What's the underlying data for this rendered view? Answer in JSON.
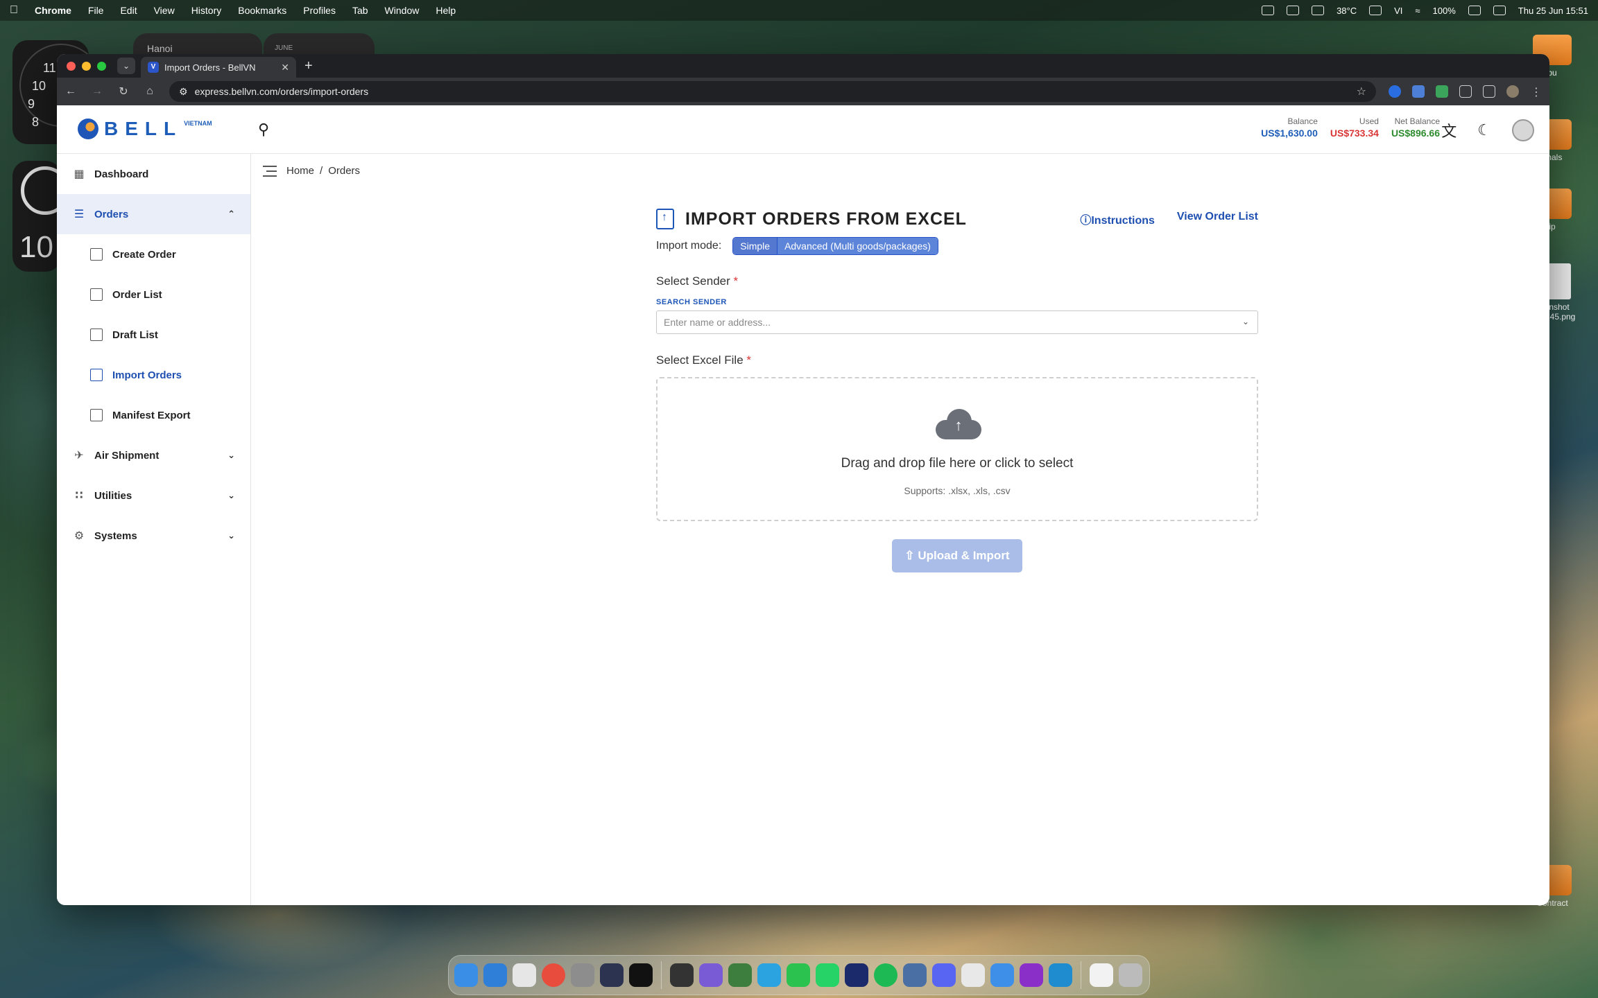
{
  "menubar": {
    "app_name": "Chrome",
    "items": [
      "File",
      "Edit",
      "View",
      "History",
      "Bookmarks",
      "Profiles",
      "Tab",
      "Window",
      "Help"
    ],
    "weather": "38°C",
    "battery": "100%",
    "input_source": "VI",
    "datetime": "Thu 25 Jun  15:51"
  },
  "desktop": {
    "weather_widget": "Hanoi",
    "calendar_widget": "JUNE",
    "battery_widget_value": "10",
    "files": [
      {
        "label": "bu"
      },
      {
        "label": "onals"
      },
      {
        "label": "ip"
      },
      {
        "label": "nshot\n2.45.png"
      },
      {
        "label": "Contract"
      }
    ]
  },
  "browser": {
    "tab_title": "Import Orders - BellVN",
    "url": "express.bellvn.com/orders/import-orders"
  },
  "header": {
    "logo_text": "BELL",
    "logo_sub": "VIETNAM",
    "balance_label": "Balance",
    "balance_value": "US$1,630.00",
    "used_label": "Used",
    "used_value": "US$733.34",
    "net_label": "Net Balance",
    "net_value": "US$896.66",
    "colors": {
      "balance": "#1e5db8",
      "used": "#d93535",
      "net": "#2e8b2e"
    }
  },
  "sidebar": {
    "items": [
      {
        "label": "Dashboard"
      },
      {
        "label": "Orders",
        "expanded": true
      },
      {
        "label": "Air Shipment"
      },
      {
        "label": "Utilities"
      },
      {
        "label": "Systems"
      }
    ],
    "orders_sub": [
      {
        "label": "Create Order"
      },
      {
        "label": "Order List"
      },
      {
        "label": "Draft List"
      },
      {
        "label": "Import Orders"
      },
      {
        "label": "Manifest Export"
      }
    ]
  },
  "breadcrumb": {
    "home": "Home",
    "separator": "/",
    "current": "Orders"
  },
  "page": {
    "title": "IMPORT ORDERS FROM EXCEL",
    "instructions_link": "Instructions",
    "view_list_link": "View Order List",
    "mode_label": "Import mode:",
    "mode_simple": "Simple",
    "mode_advanced": "Advanced (Multi goods/packages)",
    "sender_label": "Select Sender",
    "required_mark": "*",
    "search_sender_label": "SEARCH SENDER",
    "sender_placeholder": "Enter name or address...",
    "file_label": "Select Excel File",
    "drop_text": "Drag and drop file here or click to select",
    "supports_text": "Supports: .xlsx, .xls, .csv",
    "upload_button": "Upload & Import"
  }
}
